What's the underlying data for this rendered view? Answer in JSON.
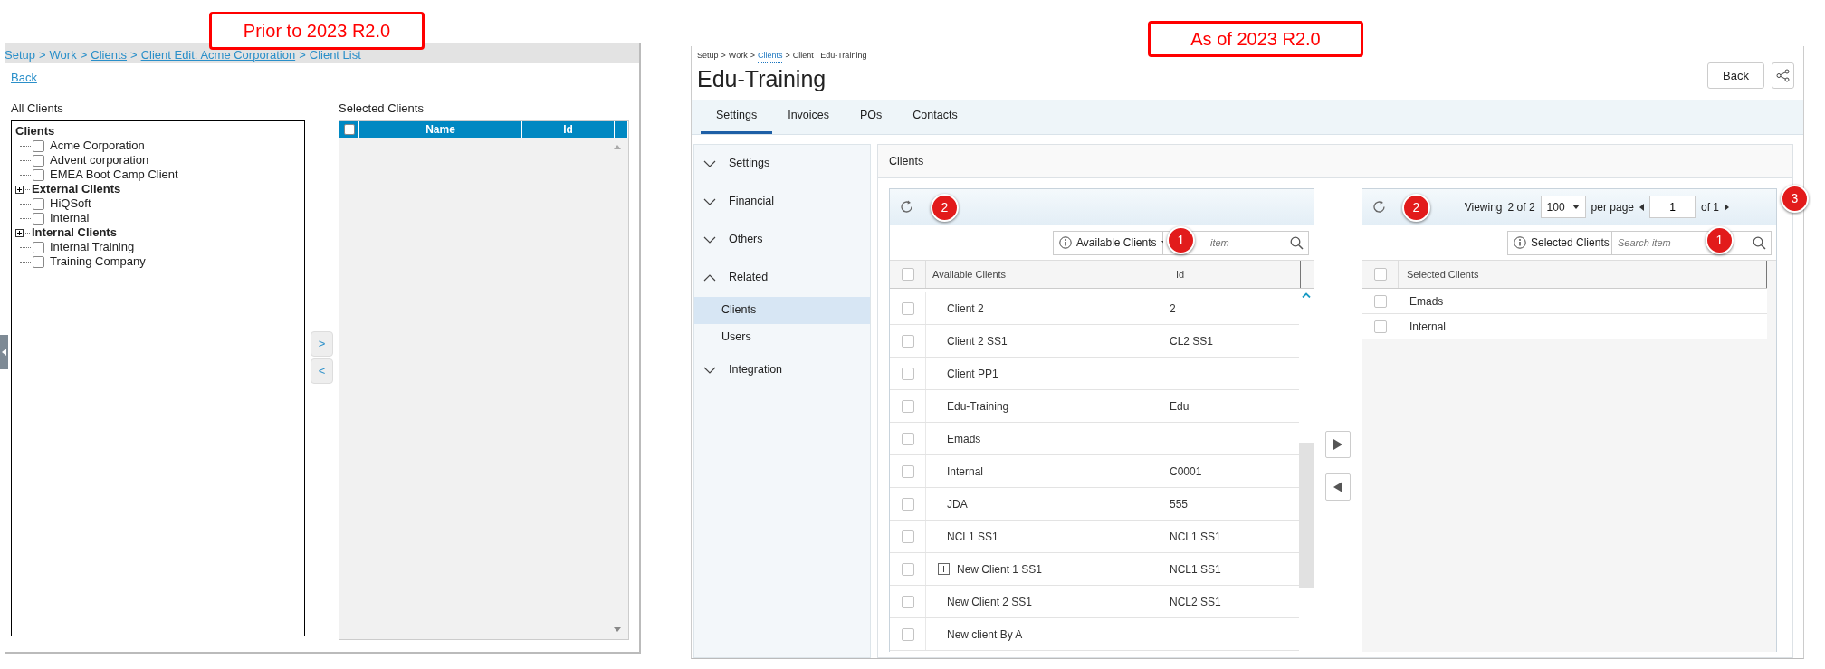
{
  "annotations": [
    {
      "text": "Prior to 2023 R2.0"
    },
    {
      "text": "As of 2023 R2.0"
    }
  ],
  "old_page": {
    "breadcrumb": [
      {
        "text": "Setup",
        "kind": "plain"
      },
      {
        "text": ">",
        "kind": "separator"
      },
      {
        "text": "Work",
        "kind": "plain"
      },
      {
        "text": ">",
        "kind": "separator"
      },
      {
        "text": "Clients",
        "kind": "link"
      },
      {
        "text": ">",
        "kind": "separator"
      },
      {
        "text": "Client Edit: Acme Corporation",
        "kind": "link"
      },
      {
        "text": ">",
        "kind": "separator"
      },
      {
        "text": "Client List",
        "kind": "plain"
      }
    ],
    "back_link": "Back",
    "all_clients": {
      "label": "All Clients",
      "tree": [
        {
          "label": "Clients",
          "expandable": false,
          "children": [
            {
              "label": "Acme Corporation",
              "checked": false
            },
            {
              "label": "Advent corporation",
              "checked": false
            },
            {
              "label": "EMEA Boot Camp Client",
              "checked": false
            }
          ]
        },
        {
          "label": "External Clients",
          "expandable": true,
          "children": [
            {
              "label": "HiQSoft",
              "checked": false
            },
            {
              "label": "Internal",
              "checked": false
            }
          ]
        },
        {
          "label": "Internal Clients",
          "expandable": true,
          "children": [
            {
              "label": "Internal Training",
              "checked": false
            },
            {
              "label": "Training Company",
              "checked": false
            }
          ]
        }
      ]
    },
    "move_buttons": [
      ">",
      "<"
    ],
    "selected_clients": {
      "label": "Selected Clients",
      "select_all_checked": false,
      "columns": [
        "Name",
        "Id"
      ]
    }
  },
  "new_page": {
    "breadcrumb": [
      {
        "text": "Setup",
        "kind": "plain"
      },
      {
        "text": ">",
        "kind": "separator"
      },
      {
        "text": "Work",
        "kind": "plain"
      },
      {
        "text": ">",
        "kind": "separator"
      },
      {
        "text": "Clients",
        "kind": "link"
      },
      {
        "text": ">",
        "kind": "separator"
      },
      {
        "text": "Client : Edu-Training",
        "kind": "plain"
      }
    ],
    "title": "Edu-Training",
    "back_button": "Back",
    "tabs": [
      {
        "label": "Settings",
        "selected": true
      },
      {
        "label": "Invoices",
        "selected": false
      },
      {
        "label": "POs",
        "selected": false
      },
      {
        "label": "Contacts",
        "selected": false
      }
    ],
    "sidebar": [
      {
        "label": "Settings",
        "expanded": false
      },
      {
        "label": "Financial",
        "expanded": false
      },
      {
        "label": "Others",
        "expanded": false
      },
      {
        "label": "Related",
        "expanded": true,
        "items": [
          {
            "label": "Clients",
            "selected": true
          },
          {
            "label": "Users",
            "selected": false
          }
        ]
      },
      {
        "label": "Integration",
        "expanded": false
      }
    ],
    "panel_title": "Clients",
    "available": {
      "refresh_callout": "2",
      "search_callout": "1",
      "dropdown": "Available Clients",
      "search_placeholder": "item",
      "select_all_checked": false,
      "columns": [
        "Available Clients",
        "Id"
      ],
      "rows": [
        {
          "name": "Client 2",
          "id": "2",
          "checked": false,
          "expandable": false
        },
        {
          "name": "Client 2 SS1",
          "id": "CL2 SS1",
          "checked": false,
          "expandable": false
        },
        {
          "name": "Client PP1",
          "id": "",
          "checked": false,
          "expandable": false
        },
        {
          "name": "Edu-Training",
          "id": "Edu",
          "checked": false,
          "expandable": false
        },
        {
          "name": "Emads",
          "id": "",
          "checked": false,
          "expandable": false
        },
        {
          "name": "Internal",
          "id": "C0001",
          "checked": false,
          "expandable": false
        },
        {
          "name": "JDA",
          "id": "555",
          "checked": false,
          "expandable": false
        },
        {
          "name": "NCL1 SS1",
          "id": "NCL1 SS1",
          "checked": false,
          "expandable": false
        },
        {
          "name": "New Client 1 SS1",
          "id": "NCL1 SS1",
          "checked": false,
          "expandable": true
        },
        {
          "name": "New Client 2 SS1",
          "id": "NCL2 SS1",
          "checked": false,
          "expandable": false
        },
        {
          "name": "New client By A",
          "id": "",
          "checked": false,
          "expandable": false
        }
      ]
    },
    "selected": {
      "refresh_callout": "2",
      "search_callout": "1",
      "pager_callout": "3",
      "viewing_label": "Viewing",
      "viewing_count": "2 of 2",
      "page_size": "100",
      "per_page_label": "per page",
      "page": "1",
      "page_total": "of 1",
      "dropdown": "Selected Clients",
      "search_placeholder": "Search item",
      "select_all_checked": false,
      "columns": [
        "Selected Clients"
      ],
      "rows": [
        {
          "name": "Emads",
          "checked": false
        },
        {
          "name": "Internal",
          "checked": false
        }
      ]
    }
  }
}
